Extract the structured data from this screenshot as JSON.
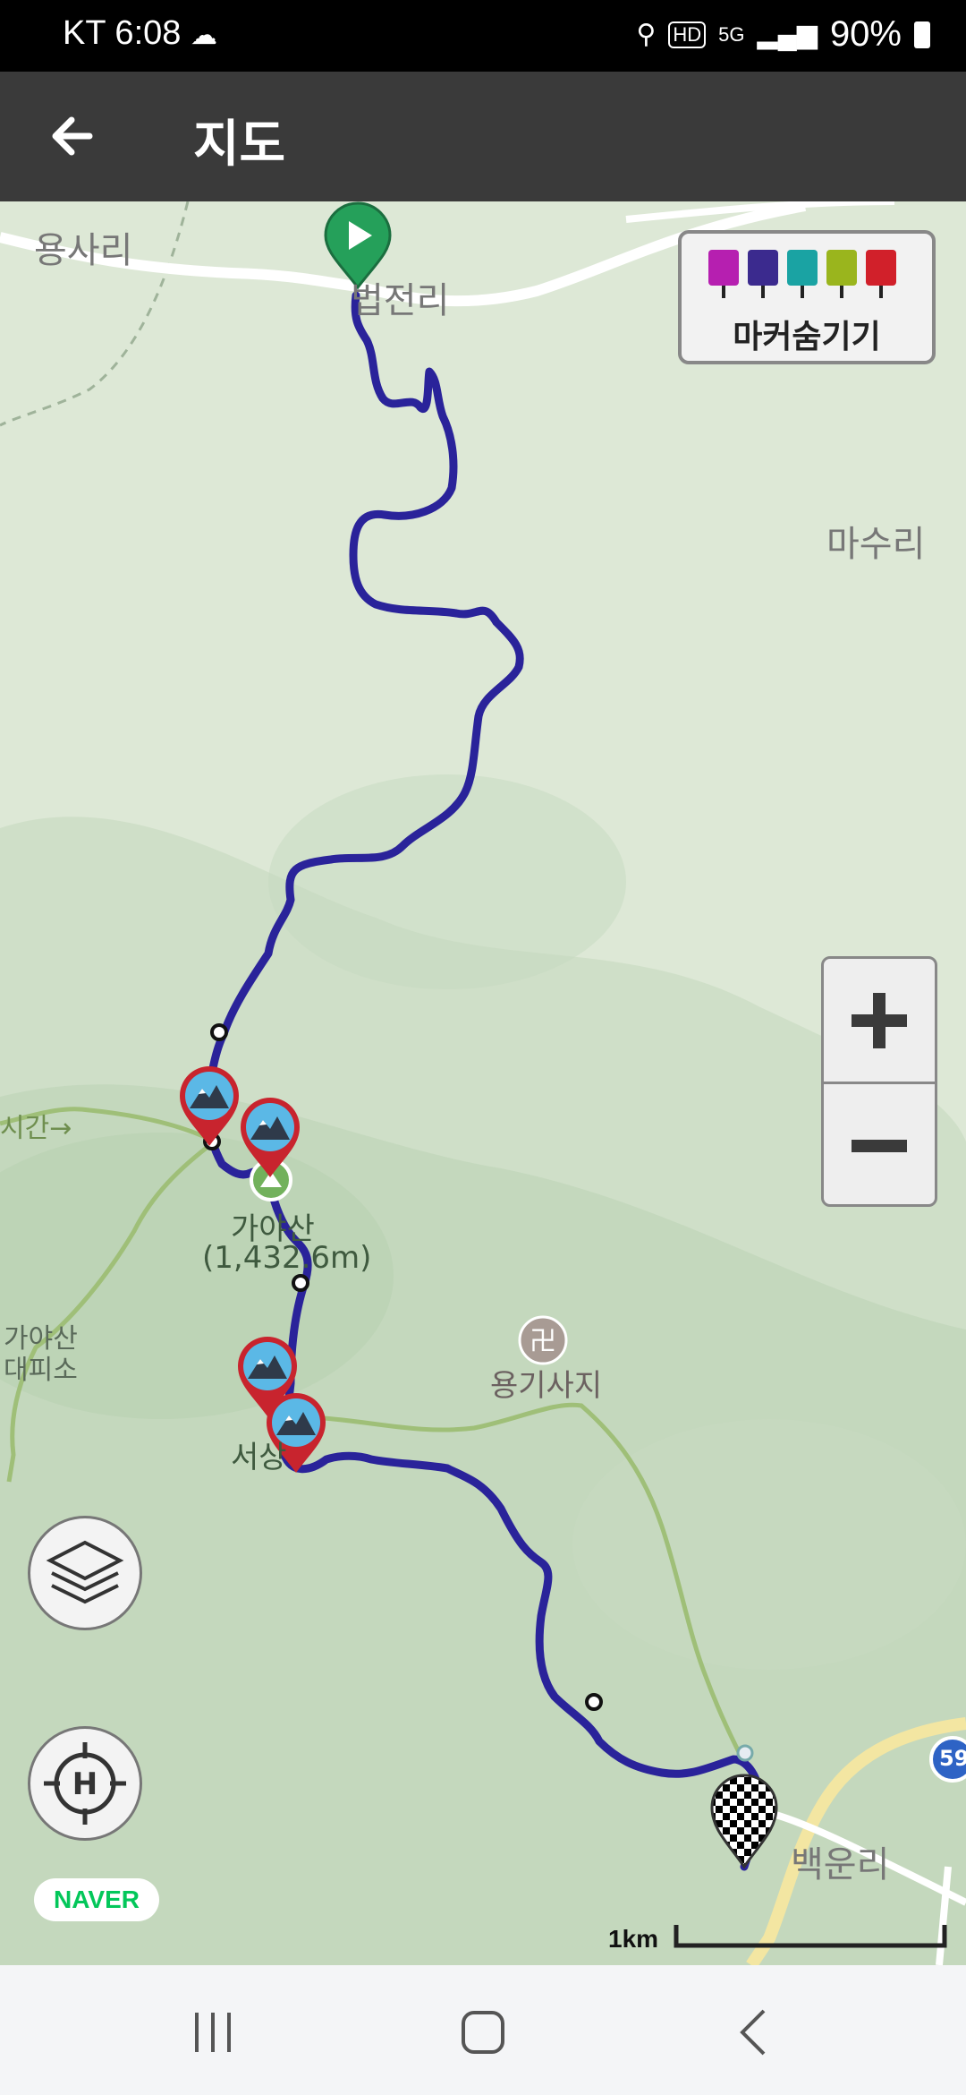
{
  "status_bar": {
    "carrier_time": "KT 6:08",
    "battery": "90%",
    "icons": [
      "cloud-icon",
      "location-icon",
      "hd-icon",
      "5g-icon",
      "signal-icon",
      "battery-icon"
    ]
  },
  "app_bar": {
    "title": "지도",
    "back_icon": "arrow-left-icon"
  },
  "map": {
    "labels": {
      "yongsari": "용사리",
      "beopjeonri": "법전리",
      "masuri": "마수리",
      "gayasan": "가야산",
      "gayasan_elev": "(1,432.6m)",
      "gayasan_shelter_1": "가야산",
      "gayasan_shelter_2": "대피소",
      "yonggisaji": "용기사지",
      "seosang": "서상",
      "baegunri": "백운리",
      "trail_time": "시간→",
      "route_number": "59"
    },
    "marker_toggle": {
      "label": "마커숨기기",
      "icons": [
        "camera-icon",
        "video-icon",
        "pin-icon",
        "note-icon",
        "flag-icon"
      ],
      "colors": [
        "#b61fb0",
        "#3b2a8e",
        "#1aa3a3",
        "#9ab51d",
        "#d1202a"
      ]
    },
    "route_color": "#2a239a",
    "trail_color": "#9fbf78",
    "road_color": "#f2e39a",
    "naver_logo": "NAVER",
    "scale": "1km"
  },
  "controls": {
    "zoom_in_icon": "plus-icon",
    "zoom_out_icon": "minus-icon",
    "layers_icon": "layers-icon",
    "home_icon": "crosshair-h-icon"
  },
  "nav_bar": {
    "icons": [
      "recent-apps-icon",
      "home-icon",
      "back-icon"
    ]
  }
}
